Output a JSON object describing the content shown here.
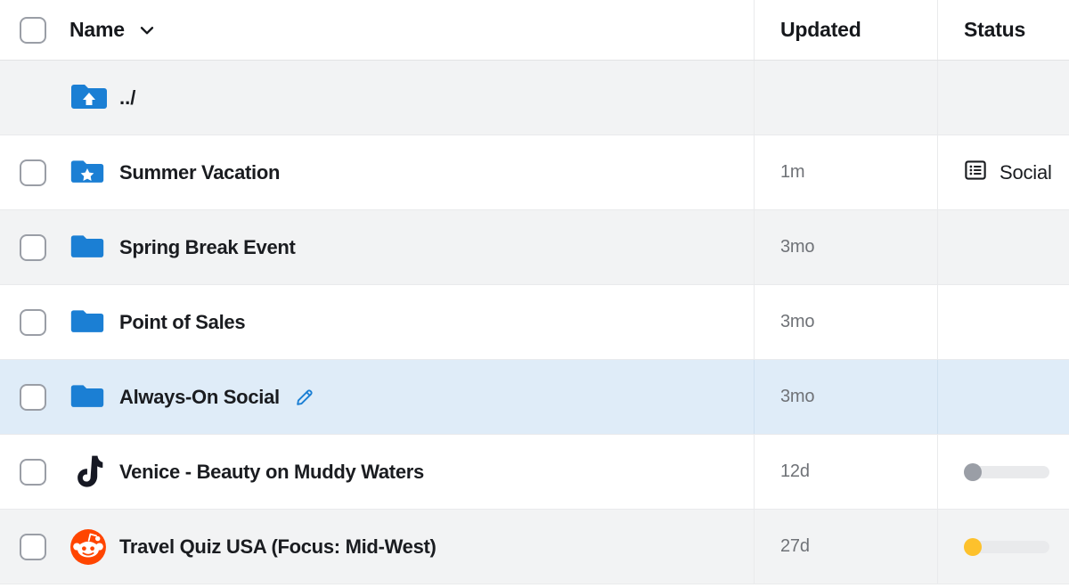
{
  "colors": {
    "folder_blue": "#1b7fd4",
    "selected_row": "#dfecf8",
    "alt_row": "#f2f3f4",
    "white_row": "#ffffff",
    "divider": "#e9eaec",
    "reddit_orange": "#ff4500",
    "tiktok_black": "#161823",
    "progress_track": "#e9eaec",
    "progress_knob_gray": "#9a9ea6",
    "progress_knob_yellow": "#fdc12c",
    "pencil_blue": "#1b7fd4",
    "muted_text": "#6f7277",
    "primary_text": "#1a1c20"
  },
  "header": {
    "select_all_checkbox": "unchecked",
    "columns": [
      {
        "label": "Name",
        "sort_icon": "chevron-down-icon"
      },
      {
        "label": "Updated"
      },
      {
        "label": "Status"
      }
    ]
  },
  "rows": [
    {
      "kind": "parent-dir",
      "name": "../",
      "icon": "folder-up-icon",
      "updated": "",
      "status": {
        "type": "none"
      },
      "checkbox": false,
      "selected": false,
      "striped": true
    },
    {
      "kind": "folder",
      "name": "Summer Vacation",
      "icon": "folder-star-icon",
      "updated": "1m",
      "status": {
        "type": "label",
        "icon": "list-view-icon",
        "text": "Social"
      },
      "checkbox": true,
      "checked": false,
      "selected": false,
      "striped": false
    },
    {
      "kind": "folder",
      "name": "Spring Break Event",
      "icon": "folder-icon",
      "updated": "3mo",
      "status": {
        "type": "none"
      },
      "checkbox": true,
      "checked": false,
      "selected": false,
      "striped": true
    },
    {
      "kind": "folder",
      "name": "Point of Sales",
      "icon": "folder-icon",
      "updated": "3mo",
      "status": {
        "type": "none"
      },
      "checkbox": true,
      "checked": false,
      "selected": false,
      "striped": false
    },
    {
      "kind": "folder",
      "name": "Always-On Social",
      "icon": "folder-icon",
      "updated": "3mo",
      "status": {
        "type": "none"
      },
      "checkbox": true,
      "checked": false,
      "selected": true,
      "striped": false,
      "edit_icon": "pencil-icon"
    },
    {
      "kind": "post",
      "name": "Venice - Beauty on Muddy Waters",
      "icon": "tiktok-icon",
      "updated": "12d",
      "status": {
        "type": "progress",
        "knob_color": "#9a9ea6",
        "percent": 0
      },
      "checkbox": true,
      "checked": false,
      "selected": false,
      "striped": false
    },
    {
      "kind": "post",
      "name": "Travel Quiz USA (Focus: Mid-West)",
      "icon": "reddit-icon",
      "updated": "27d",
      "status": {
        "type": "progress",
        "knob_color": "#fdc12c",
        "percent": 0
      },
      "checkbox": true,
      "checked": false,
      "selected": false,
      "striped": true
    }
  ]
}
